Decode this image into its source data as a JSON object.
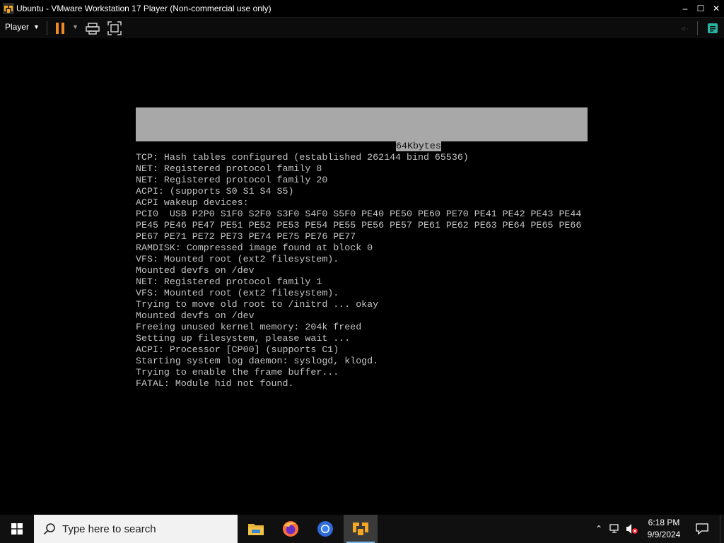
{
  "window": {
    "title": "Ubuntu - VMware Workstation 17 Player (Non-commercial use only)",
    "controls": {
      "minimize": "–",
      "maximize": "☐",
      "close": "✕"
    }
  },
  "toolbar": {
    "player_label": "Player",
    "icons": [
      "pause-icon",
      "send-ctrl-alt-del-icon",
      "full-screen-icon",
      "back-icon",
      "message-log-icon"
    ]
  },
  "console": {
    "first_line": "64Kbytes",
    "lines": [
      "TCP: Hash tables configured (established 262144 bind 65536)",
      "NET: Registered protocol family 8",
      "NET: Registered protocol family 20",
      "ACPI: (supports S0 S1 S4 S5)",
      "ACPI wakeup devices:",
      "PCI0  USB P2P0 S1F0 S2F0 S3F0 S4F0 S5F0 PE40 PE50 PE60 PE70 PE41 PE42 PE43 PE44",
      "PE45 PE46 PE47 PE51 PE52 PE53 PE54 PE55 PE56 PE57 PE61 PE62 PE63 PE64 PE65 PE66",
      "PE67 PE71 PE72 PE73 PE74 PE75 PE76 PE77",
      "RAMDISK: Compressed image found at block 0",
      "VFS: Mounted root (ext2 filesystem).",
      "Mounted devfs on /dev",
      "NET: Registered protocol family 1",
      "VFS: Mounted root (ext2 filesystem).",
      "Trying to move old root to /initrd ... okay",
      "Mounted devfs on /dev",
      "Freeing unused kernel memory: 204k freed",
      "Setting up filesystem, please wait ...",
      "ACPI: Processor [CP00] (supports C1)",
      "Starting system log daemon: syslogd, klogd.",
      "Trying to enable the frame buffer...",
      "FATAL: Module hid not found."
    ]
  },
  "taskbar": {
    "search_placeholder": "Type here to search",
    "apps": [
      "file-explorer-icon",
      "firefox-icon",
      "chrome-icon",
      "vmware-player-icon"
    ],
    "active_app": "vmware-player-icon",
    "clock_time": "6:18 PM",
    "clock_date": "9/9/2024"
  },
  "colors": {
    "console_text": "#c4c4c4",
    "redaction_gray": "#a8a8a8",
    "taskbar_bg": "#101010",
    "active_underline": "#76b9ed",
    "pause_orange": "#f08a24"
  }
}
